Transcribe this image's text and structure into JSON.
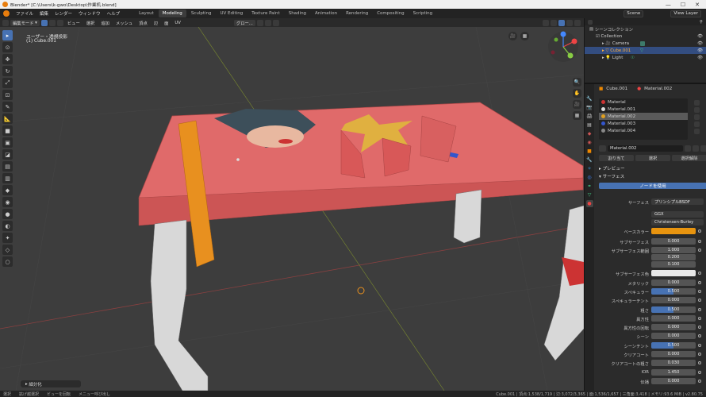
{
  "window": {
    "title": "Blender* [C:\\Users\\k-gwo\\Desktop\\作業机.blend]"
  },
  "topbar": {
    "menus": [
      "ファイル",
      "編集",
      "レンダー",
      "ウィンドウ",
      "ヘルプ"
    ],
    "workspaces": [
      "Layout",
      "Modeling",
      "Sculpting",
      "UV Editing",
      "Texture Paint",
      "Shading",
      "Animation",
      "Rendering",
      "Compositing",
      "Scripting"
    ],
    "active_workspace": "Modeling",
    "scene_label": "Scene",
    "view_layer_label": "View Layer"
  },
  "viewport_header": {
    "mode": "編集モード",
    "menus": [
      "ビュー",
      "選択",
      "追加",
      "メッシュ",
      "頂点",
      "辺",
      "面",
      "UV"
    ],
    "orientation": "グロー..."
  },
  "viewport": {
    "view_name": "ユーザー・透視投影",
    "object_name": "(1) Cube.001",
    "last_op": "細分化"
  },
  "outliner": {
    "root": "シーンコレクション",
    "collection": "Collection",
    "items": [
      {
        "label": "Camera",
        "selected": false
      },
      {
        "label": "Cube.001",
        "selected": true
      },
      {
        "label": "Light",
        "selected": false
      }
    ]
  },
  "properties": {
    "header_object": "Cube.001",
    "header_material": "Material.002",
    "slots": [
      "Material",
      "Material.001",
      "Material.002",
      "Material.003",
      "Material.004"
    ],
    "slot_colors": [
      "#c33",
      "#ddd",
      "#e0a020",
      "#3355cc",
      "#888"
    ],
    "active_slot": "Material.002",
    "material_field": "Material.002",
    "assign_btn": "割り当て",
    "select_btn": "選択",
    "deselect_btn": "選択解除",
    "preview_label": "プレビュー",
    "surface_label": "サーフェス",
    "use_nodes_btn": "ノードを使用",
    "surface_shader_label": "サーフェス",
    "surface_shader": "プリンシプルBSDF",
    "distribution": "GGX",
    "subsurface_method": "Christensen-Burley",
    "base_color_label": "ベースカラー",
    "base_color": "#e8940f",
    "rows": [
      {
        "label": "サブサーフェス",
        "value": "0.000"
      },
      {
        "label": "サブサーフェス範囲",
        "value": "1.000"
      },
      {
        "label": "",
        "value": "0.200"
      },
      {
        "label": "",
        "value": "0.100"
      },
      {
        "label": "サブサーフェス色",
        "value": ""
      },
      {
        "label": "メタリック",
        "value": "0.000"
      },
      {
        "label": "スペキュラー",
        "value": "0.500"
      },
      {
        "label": "スペキュラーチント",
        "value": "0.000"
      },
      {
        "label": "粗さ",
        "value": "0.500"
      },
      {
        "label": "異方性",
        "value": "0.000"
      },
      {
        "label": "異方性の回転",
        "value": "0.000"
      },
      {
        "label": "シーン",
        "value": "0.000"
      },
      {
        "label": "シーンチント",
        "value": "0.500"
      },
      {
        "label": "クリアコート",
        "value": "0.000"
      },
      {
        "label": "クリアコートの粗さ",
        "value": "0.030"
      },
      {
        "label": "IOR",
        "value": "1.450"
      },
      {
        "label": "伝播",
        "value": "0.000"
      }
    ]
  },
  "statusbar": {
    "left": [
      "選択",
      "拡げ越選択",
      "ビューを回転",
      "メニュー呼び出し"
    ],
    "right": "Cube.001 | 頂点:1,538/1,719 | 辺:3,072/3,365 | 面:1,536/1,657 | 三角面:3,418 | メモリ:93.6 MiB | v2.80.75"
  },
  "colors": {
    "accent": "#4772b3",
    "orange": "#e87d0d",
    "table": "#e06a6a"
  }
}
